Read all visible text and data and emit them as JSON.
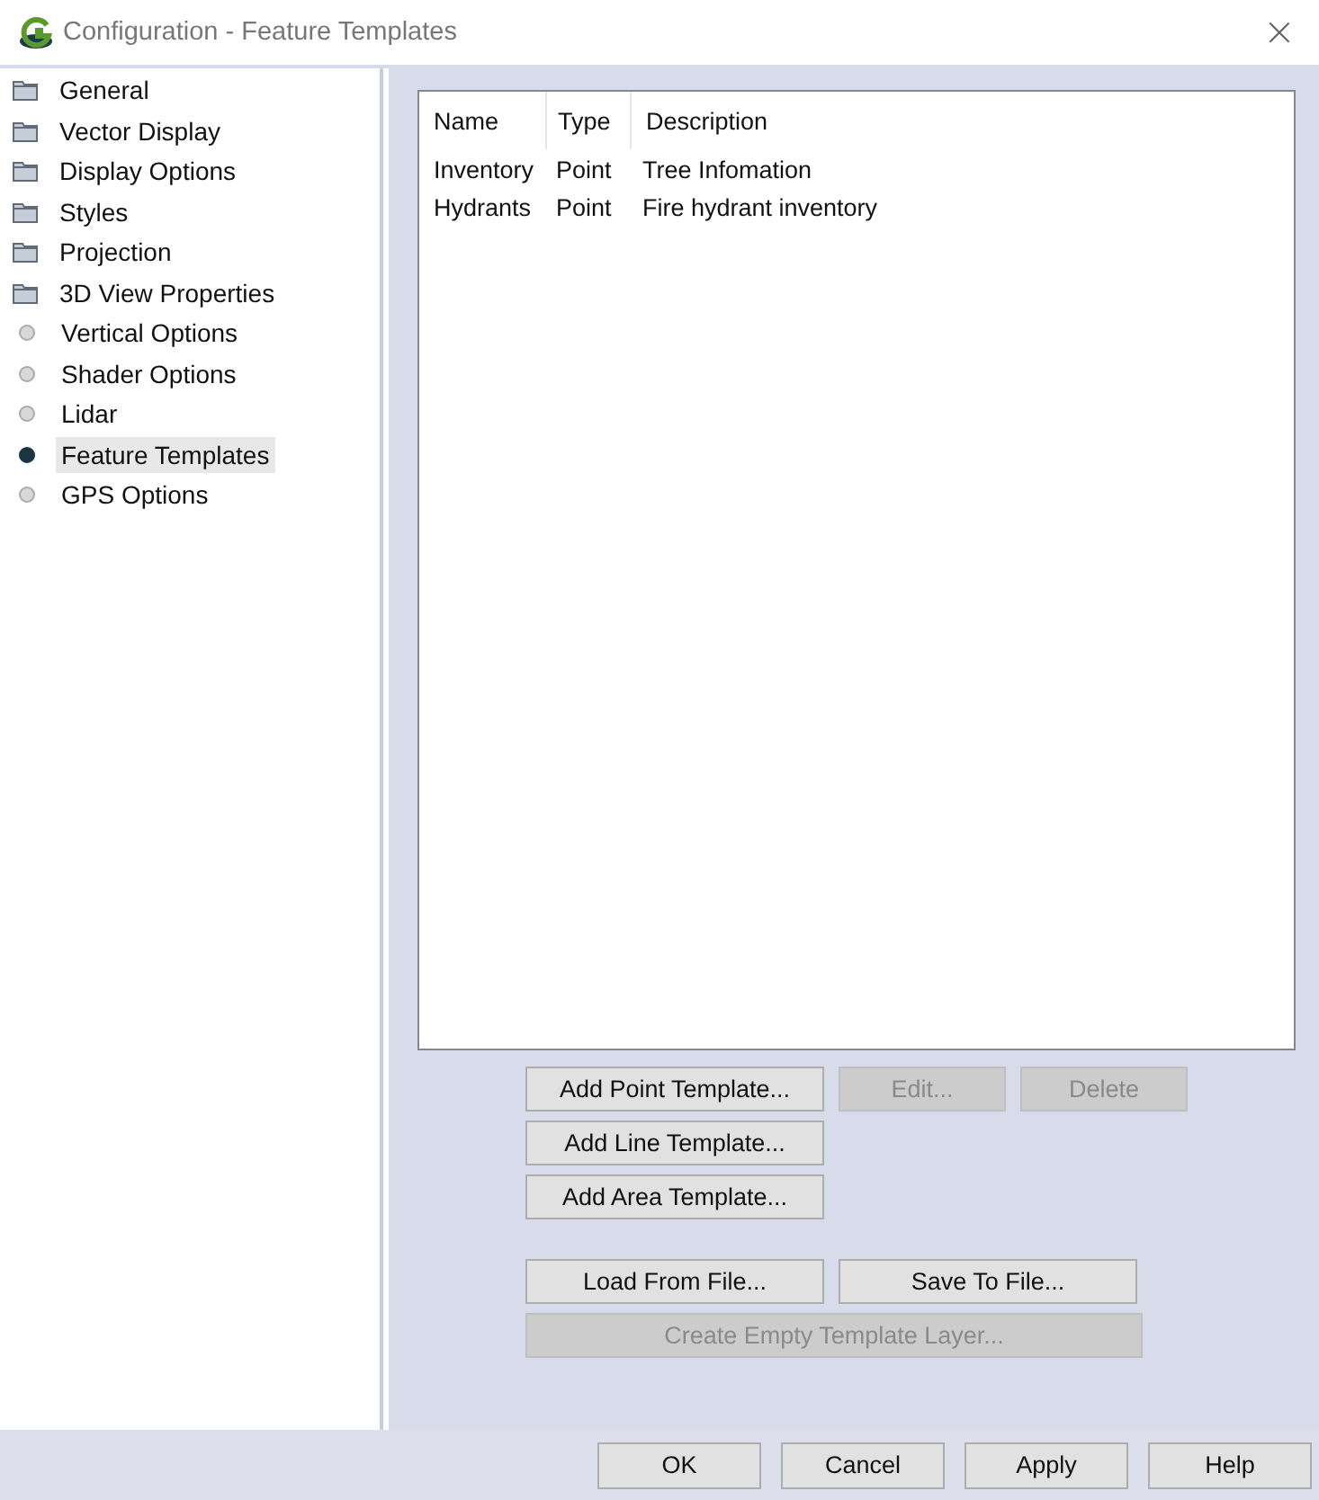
{
  "window": {
    "title": "Configuration - Feature Templates",
    "close": "×"
  },
  "sidebar": {
    "items": [
      {
        "label": "General",
        "kind": "folder",
        "selected": false
      },
      {
        "label": "Vector Display",
        "kind": "folder",
        "selected": false
      },
      {
        "label": "Display Options",
        "kind": "folder",
        "selected": false
      },
      {
        "label": "Styles",
        "kind": "folder",
        "selected": false
      },
      {
        "label": "Projection",
        "kind": "folder",
        "selected": false
      },
      {
        "label": "3D View Properties",
        "kind": "folder",
        "selected": false
      },
      {
        "label": "Vertical Options",
        "kind": "page",
        "selected": false
      },
      {
        "label": "Shader Options",
        "kind": "page",
        "selected": false
      },
      {
        "label": "Lidar",
        "kind": "page",
        "selected": false
      },
      {
        "label": "Feature Templates",
        "kind": "page",
        "selected": true
      },
      {
        "label": "GPS Options",
        "kind": "page",
        "selected": false
      }
    ]
  },
  "table": {
    "columns": [
      "Name",
      "Type",
      "Description"
    ],
    "rows": [
      [
        "Inventory",
        "Point",
        "Tree Infomation"
      ],
      [
        "Hydrants",
        "Point",
        "Fire hydrant inventory"
      ]
    ]
  },
  "button_groups": [
    {
      "rows": [
        [
          {
            "label": "Add Point Template...",
            "kind": "wide",
            "disabled": false
          },
          {
            "label": "Edit...",
            "kind": "narrow",
            "disabled": true
          },
          {
            "label": "Delete",
            "kind": "narrow",
            "disabled": true
          }
        ],
        [
          {
            "label": "Add Line Template...",
            "kind": "wide",
            "disabled": false
          }
        ],
        [
          {
            "label": "Add Area Template...",
            "kind": "wide",
            "disabled": false
          }
        ]
      ]
    },
    {
      "rows": [
        [
          {
            "label": "Load From File...",
            "kind": "wide",
            "disabled": false
          },
          {
            "label": "Save To File...",
            "kind": "wide",
            "disabled": false
          }
        ],
        [
          {
            "label": "Create Empty Template Layer...",
            "kind": "full",
            "disabled": true
          }
        ]
      ]
    }
  ],
  "footer_buttons": [
    "OK",
    "Cancel",
    "Apply",
    "Help"
  ]
}
